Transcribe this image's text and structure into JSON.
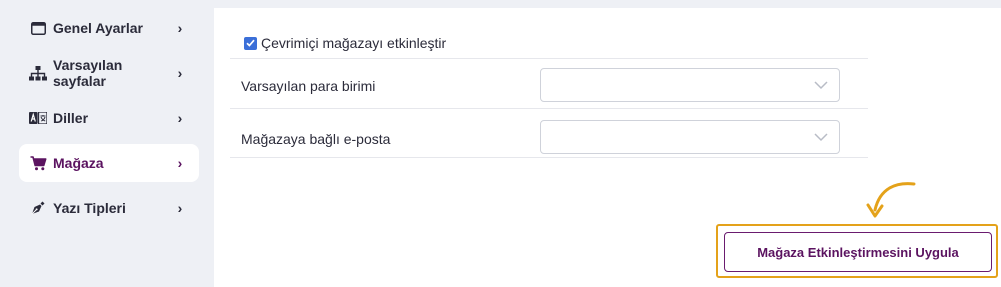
{
  "sidebar": {
    "items": [
      {
        "label": "Genel Ayarlar",
        "icon": "window-icon",
        "active": false
      },
      {
        "label": "Varsayılan sayfalar",
        "icon": "sitemap-icon",
        "active": false
      },
      {
        "label": "Diller",
        "icon": "language-icon",
        "active": false
      },
      {
        "label": "Mağaza",
        "icon": "cart-icon",
        "active": true
      },
      {
        "label": "Yazı Tipleri",
        "icon": "pen-nib-icon",
        "active": false
      }
    ],
    "chevron": "›"
  },
  "main": {
    "enable_store_label": "Çevrimiçi mağazayı etkinleştir",
    "enable_store_checked": true,
    "currency_label": "Varsayılan para birimi",
    "currency_value": "",
    "email_label": "Mağazaya bağlı e-posta",
    "email_value": "",
    "apply_button_label": "Mağaza Etkinleştirmesini Uygula"
  },
  "colors": {
    "accent": "#5b1360",
    "highlight": "#e4a21a",
    "checkbox": "#3b6fd8"
  }
}
